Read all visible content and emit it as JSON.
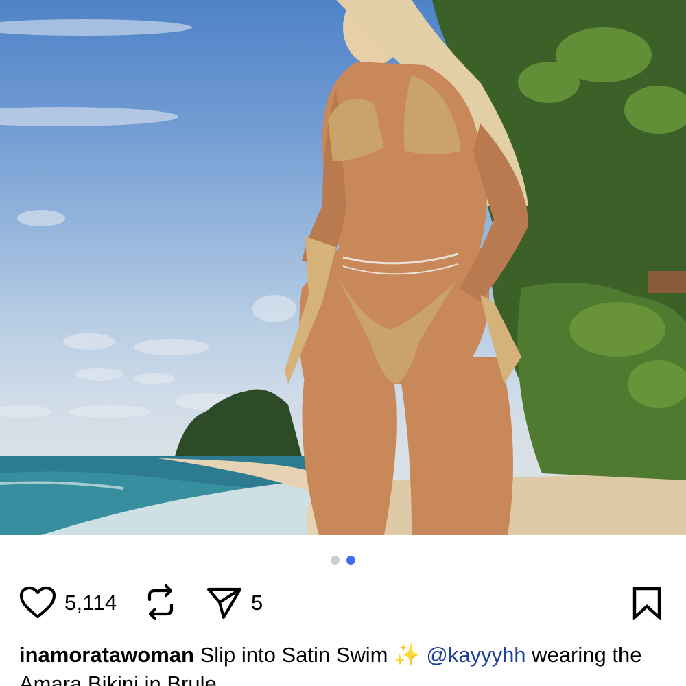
{
  "post": {
    "image": {
      "description_icon": "photo",
      "colors": {
        "sky": "#6f9ad2",
        "sea": "#2f7f93",
        "sand": "#e9d8bd",
        "foliage": "#3f6a2a",
        "swimsuit": "#c9a36a"
      }
    },
    "carousel": {
      "total": 2,
      "active_index": 1,
      "active_color": "#3f6cf2"
    },
    "actions": {
      "like_count": "5,114",
      "share_count": "5",
      "like_icon": "heart-icon",
      "repost_icon": "repost-icon",
      "share_icon": "send-icon",
      "save_icon": "bookmark-icon"
    },
    "caption": {
      "username": "inamoratawoman",
      "text_before": " Slip into Satin Swim ",
      "emoji": "✨",
      "mention": "@kayyyhh",
      "text_after": " wearing the Amara Bikini in Brule"
    }
  }
}
